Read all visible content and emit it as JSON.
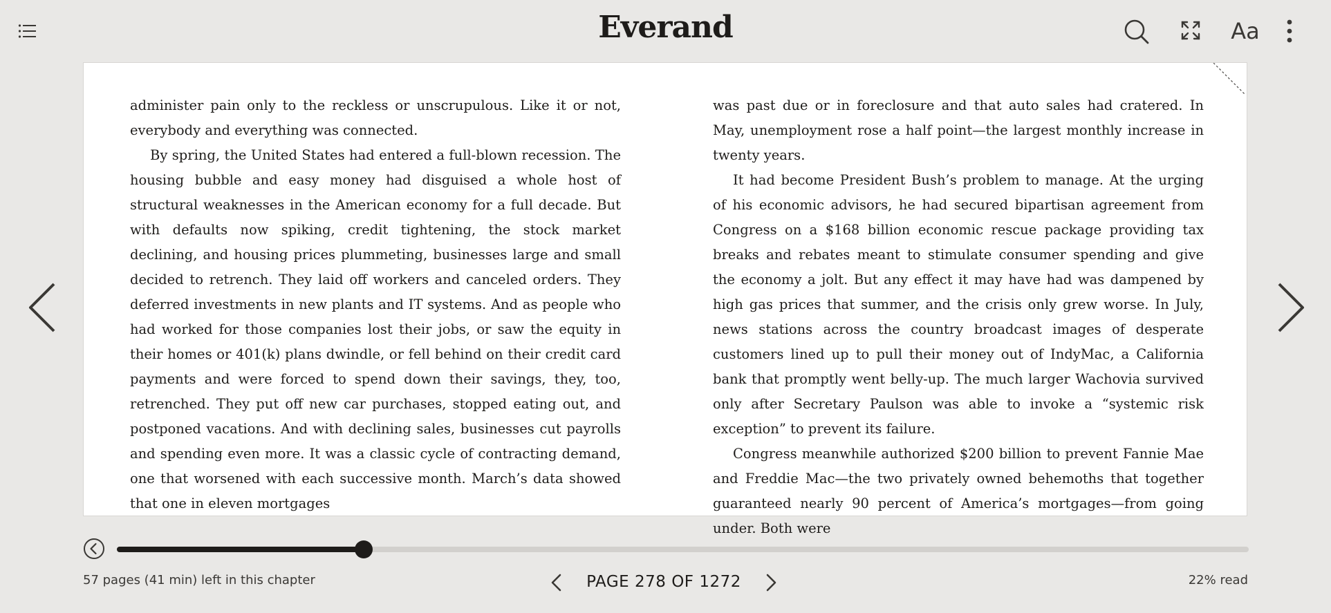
{
  "header": {
    "brand": "Everand",
    "font_button_label": "Aa",
    "icons": {
      "toc": "list-icon",
      "search": "search-icon",
      "fullscreen": "fullscreen-icon",
      "more": "more-vertical-icon"
    }
  },
  "reader": {
    "left_column": [
      "administer pain only to the reckless or unscrupulous. Like it or not, everybody and everything was connected.",
      "By spring, the United States had entered a full-blown recession. The housing bubble and easy money had disguised a whole host of structural weaknesses in the American economy for a full decade. But with defaults now spiking, credit tightening, the stock market declining, and housing prices plummeting, businesses large and small decided to retrench. They laid off workers and canceled orders. They deferred investments in new plants and IT systems. And as people who had worked for those companies lost their jobs, or saw the equity in their homes or 401(k) plans dwindle, or fell behind on their credit card payments and were forced to spend down their savings, they, too, retrenched. They put off new car purchases, stopped eating out, and postponed vacations. And with declining sales, businesses cut payrolls and spending even more. It was a classic cycle of contracting demand, one that worsened with each successive month. March’s data showed that one in eleven mortgages"
    ],
    "right_column": [
      "was past due or in foreclosure and that auto sales had cratered. In May, unemployment rose a half point—the largest monthly increase in twenty years.",
      "It had become President Bush’s problem to manage. At the urging of his economic advisors, he had secured bipartisan agreement from Congress on a $168 billion economic rescue package providing tax breaks and rebates meant to stimulate consumer spending and give the economy a jolt. But any effect it may have had was dampened by high gas prices that summer, and the crisis only grew worse. In July, news stations across the country broadcast images of desperate customers lined up to pull their money out of IndyMac, a California bank that promptly went belly-up. The much larger Wachovia survived only after Secretary Paulson was able to invoke a “systemic risk exception” to prevent its failure.",
      "Congress meanwhile authorized $200 billion to prevent Fannie Mae and Freddie Mac—the two privately owned behemoths that together guaranteed nearly 90 percent of America’s mortgages—from going under. Both were"
    ],
    "icons": {
      "prev": "chevron-left-icon",
      "next": "chevron-right-icon"
    }
  },
  "progress": {
    "fraction": 0.218,
    "back_icon": "history-back-icon"
  },
  "footer": {
    "chapter_remaining": "57 pages (41 min) left in this chapter",
    "page_indicator": "PAGE 278 OF 1272",
    "percent_read": "22% read"
  },
  "colors": {
    "background": "#e9e8e6",
    "page": "#ffffff",
    "ink": "#1e1c1a",
    "track": "#d2d0cd"
  }
}
